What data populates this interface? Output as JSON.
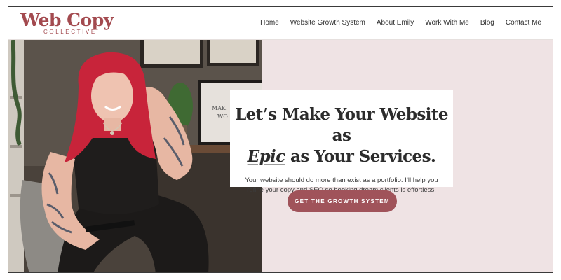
{
  "logo": {
    "main": "Web Copy",
    "sub": "COLLECTIVE"
  },
  "nav": {
    "items": [
      {
        "label": "Home",
        "active": true
      },
      {
        "label": "Website Growth System"
      },
      {
        "label": "About Emily"
      },
      {
        "label": "Work With Me"
      },
      {
        "label": "Blog"
      },
      {
        "label": "Contact Me"
      }
    ]
  },
  "hero": {
    "headline_line1": "Let’s Make Your Website as",
    "headline_em": "Epic",
    "headline_line2_rest": " as Your Services.",
    "subtext": "Your website should do more than exist as a portfolio. I’ll help you refine your copy and SEO so booking dream clients is effortless.",
    "cta_label": "GET THE GROWTH SYSTEM",
    "photo_monitor_text": "MAK WO"
  },
  "colors": {
    "brand": "#a34a4f",
    "cta": "#a0535a",
    "hero_bg": "#efe3e4",
    "text": "#2c2c2c"
  }
}
